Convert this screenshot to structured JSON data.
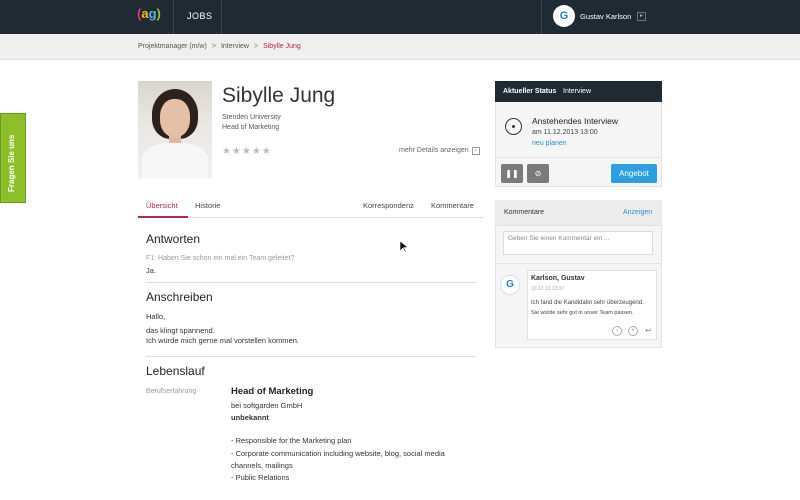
{
  "topbar": {
    "logo": {
      "p1": "(",
      "p2": "a",
      "p3": "g",
      "p4": ")"
    },
    "jobs": "JOBS",
    "avatar_letter": "G",
    "user_name": "Gustav Karlson"
  },
  "breadcrumb": [
    "Projektmanager (m/w)",
    "Interview",
    "Sibylle Jung"
  ],
  "feedback_tab": "Fragen Sie uns",
  "profile": {
    "name": "Sibylle Jung",
    "school": "Stenden University",
    "role": "Head of Marketing",
    "stars": "★★★★★",
    "rating": 0,
    "more_details": "mehr Details anzeigen"
  },
  "tabs": {
    "overview": "Übersicht",
    "history": "Historie",
    "correspondence": "Korrespondenz",
    "comments": "Kommentare"
  },
  "answers": {
    "title": "Antworten",
    "question": "F1: Haben Sie schon ein mal ein Team geleitet?",
    "answer": "Ja."
  },
  "letter": {
    "title": "Anschreiben",
    "greeting": "Hallo,",
    "line1": "das klingt spannend.",
    "line2": "Ich würde mich gerne mal vorstellen kommen."
  },
  "cv": {
    "title": "Lebenslauf",
    "label": "Berufserfahrung",
    "job_title": "Head of Marketing",
    "company": "bei softgarden GmbH",
    "period": "unbekannt",
    "bullets": [
      "- Responsible for the Marketing plan",
      "- Corporate communication including website, blog, social media",
      "channels, mailings",
      "- Public Relations"
    ]
  },
  "status": {
    "head_label": "Aktueller Status",
    "head_value": "Interview",
    "title": "Anstehendes Interview",
    "date": "am 11.12.2013 13:00",
    "link": "neu planen",
    "pause_icon": "pause-icon",
    "cancel_icon": "cancel-icon",
    "offer": "Angebot"
  },
  "comments": {
    "head": "Kommentare",
    "show": "Anzeigen",
    "placeholder": "Geben Sie einen Kommentar ein ...",
    "avatar_letter": "G",
    "author": "Karlson, Gustav",
    "date": "10.12.13 13:37",
    "text1": "Ich fand die Kandidatin sehr überzeugend.",
    "text2": "Sie würde sehr gut in unser Team passen."
  },
  "colors": {
    "topbar": "#1f2a33",
    "accent": "#b3264e",
    "link": "#2a8dc5",
    "primary_button": "#2d9ee0",
    "feedback_tab": "#8dbf2a"
  }
}
